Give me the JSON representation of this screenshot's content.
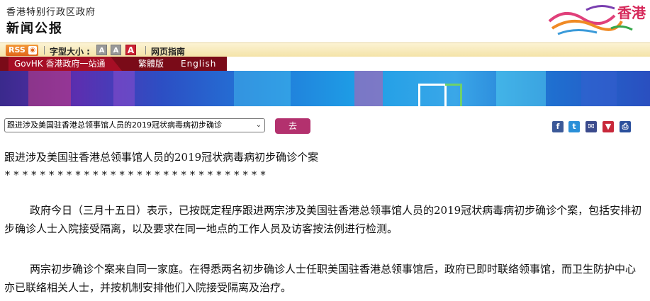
{
  "header": {
    "gov_name": "香港特别行政区政府",
    "press_title": "新闻公报",
    "brand_text": "香港",
    "brand_color": "#d6285a"
  },
  "toolbar": {
    "rss_label": "RSS",
    "rss_icon": "rss-feed-icon",
    "font_size_label": "字型大小 :",
    "font_small": "A",
    "font_medium": "A",
    "font_large": "A",
    "guide_label": "网页指南"
  },
  "nav": {
    "govhk": "GovHK 香港政府一站通",
    "traditional": "繁體版",
    "english": "English"
  },
  "topic_select": {
    "value": "跟进涉及美国驻香港总领事馆人员的2019冠状病毒病初步确诊",
    "go_label": "去"
  },
  "share": {
    "facebook_icon": "facebook-icon",
    "twitter_icon": "twitter-icon",
    "email_icon": "email-icon",
    "bookmark_icon": "bookmark-icon",
    "print_icon": "print-icon"
  },
  "article": {
    "title": "跟进涉及美国驻香港总领事馆人员的2019冠状病毒病初步确诊个案",
    "stars": "******************************",
    "paragraphs": [
      "政府今日（三月十五日）表示，已按既定程序跟进两宗涉及美国驻香港总领事馆人员的2019冠状病毒病初步确诊个案，包括安排初步确诊人士入院接受隔离，以及要求在同一地点的工作人员及访客按法例进行检测。",
      "两宗初步确诊个案来自同一家庭。在得悉两名初步确诊人士任职美国驻香港总领事馆后，政府已即时联络领事馆，而卫生防护中心亦已联络相关人士，并按机制安排他们入院接受隔离及治疗。"
    ]
  },
  "colors": {
    "nav_bg": "#7a0b18",
    "nav_active": "#a60e25",
    "go_button": "#b3316e",
    "toolbar_bg": "#f4e3a8"
  }
}
